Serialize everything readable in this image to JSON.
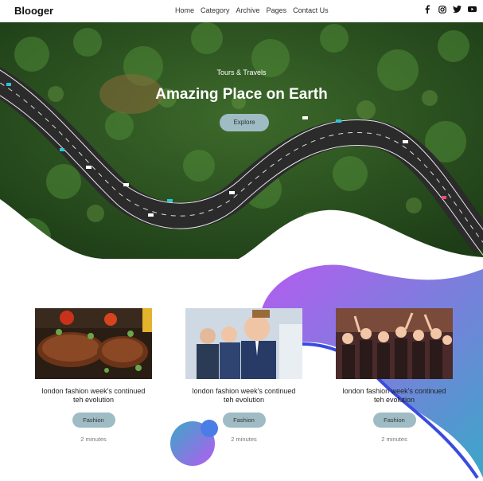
{
  "brand": "Blooger",
  "menu": [
    {
      "label": "Home"
    },
    {
      "label": "Category"
    },
    {
      "label": "Archive"
    },
    {
      "label": "Pages"
    },
    {
      "label": "Contact Us"
    }
  ],
  "social_icons": [
    "facebook-icon",
    "instagram-icon",
    "twitter-icon",
    "youtube-icon"
  ],
  "hero": {
    "subtitle": "Tours & Travels",
    "title": "Amazing Place on Earth",
    "button_label": "Explore"
  },
  "cards": [
    {
      "title": "london fashion week's continued teh evolution",
      "tag": "Fashion",
      "time": "2 minutes"
    },
    {
      "title": "london fashion week's continued teh evolution",
      "tag": "Fashion",
      "time": "2 minutes"
    },
    {
      "title": "london fashion week's continued teh evolution",
      "tag": "Fashion",
      "time": "2 minutes"
    }
  ],
  "colors": {
    "accent": "#9fbcc4",
    "forest": "#2f5a22",
    "road": "#2b2b2b",
    "gradient_purple": "#b45cf0",
    "gradient_blue": "#3aa7c8"
  }
}
